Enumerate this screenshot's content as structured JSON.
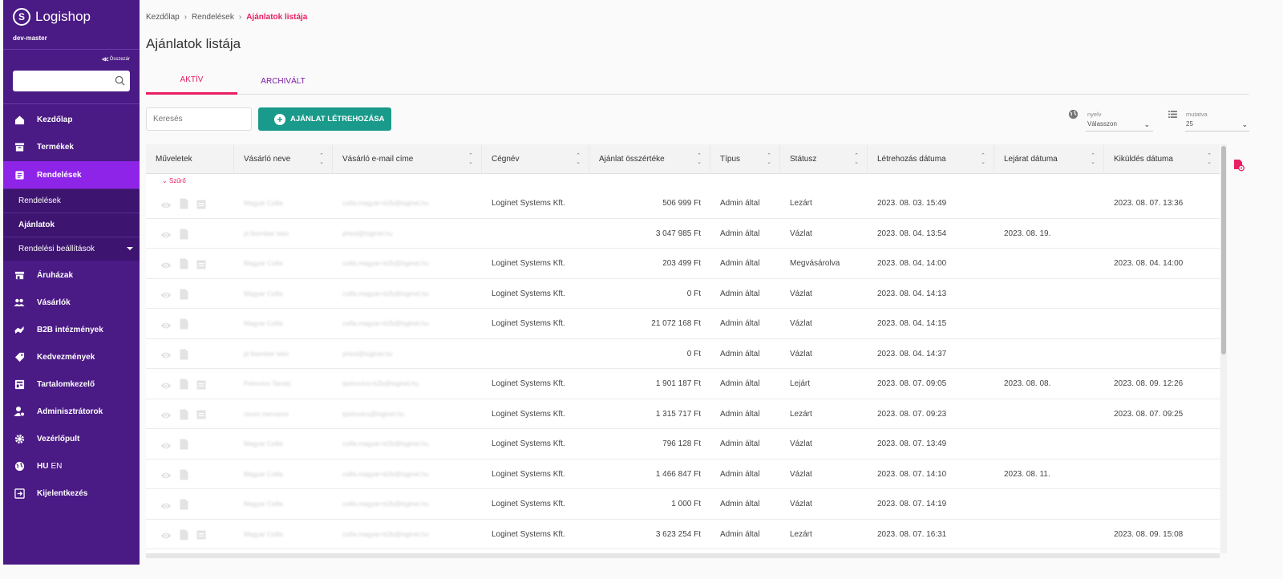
{
  "app": {
    "brand": "Logishop",
    "env": "dev-master"
  },
  "sidebar": {
    "collapse_label": "Összezár",
    "search_placeholder": "",
    "items": [
      {
        "label": "Kezdőlap",
        "icon": "home-icon"
      },
      {
        "label": "Termékek",
        "icon": "products-icon"
      },
      {
        "label": "Rendelések",
        "icon": "orders-icon",
        "active": true
      },
      {
        "label": "Áruházak",
        "icon": "store-icon"
      },
      {
        "label": "Vásárlók",
        "icon": "customers-icon"
      },
      {
        "label": "B2B intézmények",
        "icon": "handshake-icon"
      },
      {
        "label": "Kedvezmények",
        "icon": "tag-icon"
      },
      {
        "label": "Tartalomkezelő",
        "icon": "content-icon"
      },
      {
        "label": "Adminisztrátorok",
        "icon": "admin-icon"
      },
      {
        "label": "Vezérlőpult",
        "icon": "gear-icon"
      },
      {
        "lang_active": "HU",
        "lang_other": "EN",
        "icon": "globe-icon"
      },
      {
        "label": "Kijelentkezés",
        "icon": "logout-icon"
      }
    ],
    "subitems": [
      {
        "label": "Rendelések"
      },
      {
        "label": "Ajánlatok"
      },
      {
        "label": "Rendelési beállítások"
      }
    ]
  },
  "breadcrumb": {
    "home": "Kezdőlap",
    "parent": "Rendelések",
    "current": "Ajánlatok listája"
  },
  "page_title": "Ajánlatok listája",
  "tabs": [
    {
      "label": "AKTÍV"
    },
    {
      "label": "ARCHIVÁLT"
    }
  ],
  "toolbar": {
    "search_placeholder": "Keresés",
    "create_label": "AJÁNLAT LÉTREHOZÁSA",
    "lang_label": "nyelv",
    "lang_value": "Válasszon",
    "perpage_label": "mutatva",
    "perpage_value": "25"
  },
  "table": {
    "headers": [
      "Műveletek",
      "Vásárló neve",
      "Vásárló e-mail címe",
      "Cégnév",
      "Ajánlat összértéke",
      "Típus",
      "Státusz",
      "Létrehozás dátuma",
      "Lejárat dátuma",
      "Kiküldés dátuma"
    ],
    "filter_label": "Szűrő",
    "rows": [
      {
        "name": "Magyar Csilla",
        "email": "csilla.magyar+b2b@loginet.hu",
        "company": "Loginet Systems Kft.",
        "total": "506 999 Ft",
        "type": "Admin által",
        "status": "Lezárt",
        "created": "2023. 08. 03. 15:49",
        "expires": "",
        "sent": "2023. 08. 07. 13:36",
        "extra_icon": true
      },
      {
        "name": "pl llsember teko",
        "email": "phest@loginet.hu",
        "company": "",
        "total": "3 047 985 Ft",
        "type": "Admin által",
        "status": "Vázlat",
        "created": "2023. 08. 04. 13:54",
        "expires": "2023. 08. 19.",
        "sent": "",
        "extra_icon": false
      },
      {
        "name": "Magyar Csilla",
        "email": "csilla.magyar+b2b@loginet.hu",
        "company": "Loginet Systems Kft.",
        "total": "203 499 Ft",
        "type": "Admin által",
        "status": "Megvásárolva",
        "created": "2023. 08. 04. 14:00",
        "expires": "",
        "sent": "2023. 08. 04. 14:00",
        "extra_icon": true
      },
      {
        "name": "Magyar Csilla",
        "email": "csilla.magyar+b2b@loginet.hu",
        "company": "Loginet Systems Kft.",
        "total": "0 Ft",
        "type": "Admin által",
        "status": "Vázlat",
        "created": "2023. 08. 04. 14:13",
        "expires": "",
        "sent": "",
        "extra_icon": false
      },
      {
        "name": "Magyar Csilla",
        "email": "csilla.magyar+b2b@loginet.hu",
        "company": "Loginet Systems Kft.",
        "total": "21 072 168 Ft",
        "type": "Admin által",
        "status": "Vázlat",
        "created": "2023. 08. 04. 14:15",
        "expires": "",
        "sent": "",
        "extra_icon": false
      },
      {
        "name": "pl llsember teko",
        "email": "phest@loginet.hu",
        "company": "",
        "total": "0 Ft",
        "type": "Admin által",
        "status": "Vázlat",
        "created": "2023. 08. 04. 14:37",
        "expires": "",
        "sent": "",
        "extra_icon": false
      },
      {
        "name": "Petrovics Tamás",
        "email": "tpetrovics+b2b@loginet.hu",
        "company": "Loginet Systems Kft.",
        "total": "1 901 187 Ft",
        "type": "Admin által",
        "status": "Lejárt",
        "created": "2023. 08. 07. 09:05",
        "expires": "2023. 08. 08.",
        "sent": "2023. 08. 09. 12:26",
        "extra_icon": true
      },
      {
        "name": "neuro mervaros",
        "email": "tpetrovics@loginet.hu",
        "company": "Loginet Systems Kft.",
        "total": "1 315 717 Ft",
        "type": "Admin által",
        "status": "Lezárt",
        "created": "2023. 08. 07. 09:23",
        "expires": "",
        "sent": "2023. 08. 07. 09:25",
        "extra_icon": true
      },
      {
        "name": "Magyar Csilla",
        "email": "csilla.magyar+b2b@loginet.hu",
        "company": "Loginet Systems Kft.",
        "total": "796 128 Ft",
        "type": "Admin által",
        "status": "Vázlat",
        "created": "2023. 08. 07. 13:49",
        "expires": "",
        "sent": "",
        "extra_icon": false
      },
      {
        "name": "Magyar Csilla",
        "email": "csilla.magyar+b2b@loginet.hu",
        "company": "Loginet Systems Kft.",
        "total": "1 466 847 Ft",
        "type": "Admin által",
        "status": "Vázlat",
        "created": "2023. 08. 07. 14:10",
        "expires": "2023. 08. 11.",
        "sent": "",
        "extra_icon": false
      },
      {
        "name": "Magyar Csilla",
        "email": "csilla.magyar+b2b@loginet.hu",
        "company": "Loginet Systems Kft.",
        "total": "1 000 Ft",
        "type": "Admin által",
        "status": "Vázlat",
        "created": "2023. 08. 07. 14:19",
        "expires": "",
        "sent": "",
        "extra_icon": false
      },
      {
        "name": "Magyar Csilla",
        "email": "csilla.magyar+b2b@loginet.hu",
        "company": "Loginet Systems Kft.",
        "total": "3 623 254 Ft",
        "type": "Admin által",
        "status": "Lezárt",
        "created": "2023. 08. 07. 16:31",
        "expires": "",
        "sent": "2023. 08. 09. 15:08",
        "extra_icon": true
      }
    ]
  },
  "colors": {
    "sidebar": "#4a1a85",
    "active_nav": "#8e24e8",
    "accent": "#e91e63",
    "primary_button": "#1a9a8a",
    "tab_inactive": "#7b1fa2"
  }
}
